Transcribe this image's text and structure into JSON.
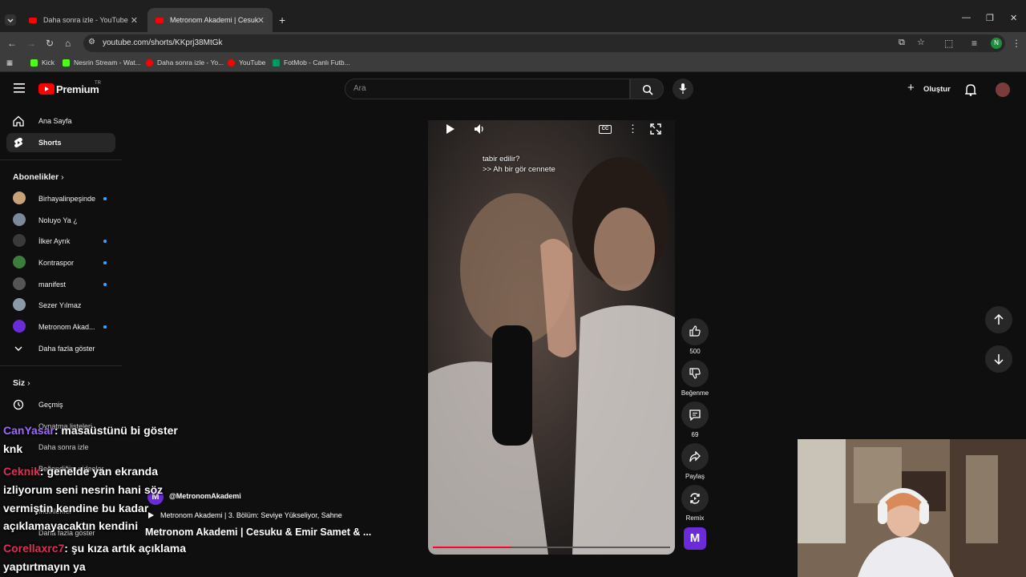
{
  "browser": {
    "tabs": [
      {
        "title": "Daha sonra izle - YouTube",
        "active": false
      },
      {
        "title": "Metronom Akademi | Cesuku &",
        "active": true
      }
    ],
    "url": "youtube.com/shorts/KKprj38MtGk",
    "bookmarks": [
      {
        "label": "Kick",
        "color": "#53fc18"
      },
      {
        "label": "Nesrin Stream - Wat...",
        "color": "#53fc18"
      },
      {
        "label": "Daha sonra izle - Yo...",
        "color": "#ff0000"
      },
      {
        "label": "YouTube",
        "color": "#ff0000"
      },
      {
        "label": "FotMob - Canlı Futb...",
        "color": "#00985f"
      }
    ]
  },
  "yt": {
    "logo_text": "Premium",
    "logo_badge": "TR",
    "search_placeholder": "Ara",
    "create_label": "Oluştur"
  },
  "sidebar": {
    "main": [
      {
        "label": "Ana Sayfa",
        "icon": "home-icon"
      },
      {
        "label": "Shorts",
        "icon": "shorts-icon",
        "active": true
      }
    ],
    "subs_title": "Abonelikler",
    "subs": [
      {
        "label": "Birhayalinpeşinde",
        "dot": true,
        "color": "#c9a27a"
      },
      {
        "label": "Noluyo Ya ¿",
        "dot": false,
        "color": "#7a8a9a"
      },
      {
        "label": "İlker Ayrık",
        "dot": true,
        "color": "#3a3a3a"
      },
      {
        "label": "Kontraspor",
        "dot": true,
        "color": "#3c7d3c"
      },
      {
        "label": "manifest",
        "dot": true,
        "color": "#555"
      },
      {
        "label": "Sezer Yılmaz",
        "dot": false,
        "color": "#8a9aa8"
      },
      {
        "label": "Metronom Akad...",
        "dot": true,
        "color": "#6b2bd9"
      }
    ],
    "show_more": "Daha fazla göster",
    "you_title": "Siz",
    "you_items": [
      {
        "label": "Geçmiş"
      },
      {
        "label": "Oynatma listeleri"
      },
      {
        "label": "Daha sonra izle"
      },
      {
        "label": "Beğendiğim videolar"
      },
      {
        "label": "İndirilenler"
      },
      {
        "label": "Daha fazla göster"
      }
    ]
  },
  "short": {
    "caption_lines": [
      "tabir edilir?",
      ">> Ah bir gör cennete"
    ],
    "channel": "@MetronomAkademi",
    "subtitle": "Metronom Akademi | 3. Bölüm: Seviye Yükseliyor, Sahne",
    "title": "Metronom Akademi | Cesuku & Emir Samet & ...",
    "progress": 0.33,
    "likes": "500",
    "dislike_label": "Beğenme",
    "comments": "69",
    "share_label": "Paylaş",
    "remix_label": "Remix"
  },
  "chat": [
    {
      "user": "CanYasar",
      "text": ": masaüstünü bi göster"
    },
    {
      "user": "",
      "text": "knk"
    },
    {
      "user": "Ceknik",
      "text": ": genelde yan ekranda"
    },
    {
      "user": "",
      "text": "izliyorum seni nesrin hani söz"
    },
    {
      "user": "",
      "text": "vermiştin kendine bu kadar"
    },
    {
      "user": "",
      "text": "açıklamayacaktın kendini"
    },
    {
      "user": "Corellaxrc7",
      "text": ": şu kıza artık açıklama"
    },
    {
      "user": "",
      "text": "yaptırtmayın ya"
    }
  ],
  "colors": {
    "accent_red": "#ff0033",
    "subscribe_dot": "#3ea6ff",
    "chat_user_purple": "#9b6bff",
    "chat_user_red": "#e0305a"
  }
}
